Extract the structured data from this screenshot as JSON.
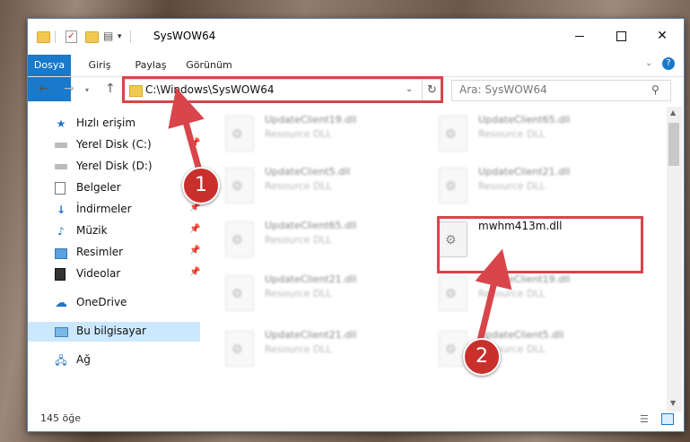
{
  "window": {
    "title": "SysWOW64",
    "controls": {
      "minimize": "—",
      "maximize": "☐",
      "close": "✕"
    }
  },
  "ribbon": {
    "tabs": [
      "Dosya",
      "Giriş",
      "Paylaş",
      "Görünüm"
    ],
    "help": "?"
  },
  "navigation": {
    "back": "←",
    "forward": "→",
    "up": "↑",
    "address": "C:\\Windows\\SysWOW64",
    "search_placeholder": "Ara: SysWOW64"
  },
  "sidebar": {
    "items": [
      {
        "label": "Hızlı erişim",
        "icon": "star-icon",
        "pinned": false
      },
      {
        "label": "Yerel Disk (C:)",
        "icon": "drive-icon",
        "pinned": true
      },
      {
        "label": "Yerel Disk (D:)",
        "icon": "drive-icon",
        "pinned": false
      },
      {
        "label": "Belgeler",
        "icon": "document-icon",
        "pinned": true
      },
      {
        "label": "İndirmeler",
        "icon": "download-icon",
        "pinned": true
      },
      {
        "label": "Müzik",
        "icon": "music-icon",
        "pinned": true
      },
      {
        "label": "Resimler",
        "icon": "pictures-icon",
        "pinned": true
      },
      {
        "label": "Videolar",
        "icon": "video-icon",
        "pinned": true
      },
      {
        "label": "OneDrive",
        "icon": "cloud-icon",
        "pinned": false
      },
      {
        "label": "Bu bilgisayar",
        "icon": "computer-icon",
        "pinned": false,
        "selected": true
      },
      {
        "label": "Ağ",
        "icon": "network-icon",
        "pinned": false
      }
    ]
  },
  "files": [
    {
      "name": "UpdateClient19.dll",
      "type": "Resource DLL",
      "blurred": true
    },
    {
      "name": "UpdateClient65.dll",
      "type": "Resource DLL",
      "blurred": true
    },
    {
      "name": "UpdateClient5.dll",
      "type": "Resource DLL",
      "blurred": true
    },
    {
      "name": "UpdateClient21.dll",
      "type": "Resource DLL",
      "blurred": true
    },
    {
      "name": "UpdateClient65.dll",
      "type": "Resource DLL",
      "blurred": true
    },
    {
      "name": "mwhm413m.dll",
      "type": "",
      "blurred": false
    },
    {
      "name": "UpdateClient21.dll",
      "type": "Resource DLL",
      "blurred": true
    },
    {
      "name": "UpdateClient19.dll",
      "type": "Resource DLL",
      "blurred": true
    },
    {
      "name": "UpdateClient21.dll",
      "type": "Resource DLL",
      "blurred": true
    },
    {
      "name": "UpdateClient5.dll",
      "type": "Resource DLL",
      "blurred": true
    }
  ],
  "status": {
    "item_count": "145 öğe"
  },
  "annotations": {
    "step1": "1",
    "step2": "2",
    "highlight_color": "#d8454a",
    "badge_color": "#c9302c"
  }
}
